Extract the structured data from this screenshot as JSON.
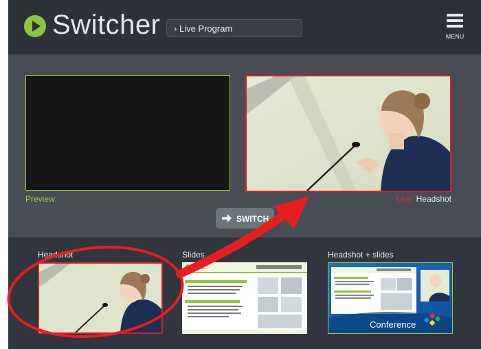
{
  "header": {
    "logo_icon": "play-circle-icon",
    "title": "Switcher",
    "program_select": "Live Program",
    "program_select_icon": "chevron-right-icon",
    "menu_label": "MENU",
    "menu_icon": "hamburger-icon"
  },
  "preview": {
    "label": "Preview:"
  },
  "live": {
    "label_prefix": "Live:",
    "label_source": "Headshot"
  },
  "switch_button": {
    "label": "SWITCH",
    "icon": "arrow-right-icon"
  },
  "sources": [
    {
      "label": "Headshot"
    },
    {
      "label": "Slides"
    },
    {
      "label": "Headshot + slides"
    }
  ],
  "colors": {
    "header_bg": "#2d323a",
    "stage_bg": "#474c55",
    "sources_bg": "#31363e",
    "logo_green": "#8dc63f",
    "preview_green": "#9ccc3a",
    "live_red": "#d81f26",
    "annotation_red": "#e81e1e"
  }
}
